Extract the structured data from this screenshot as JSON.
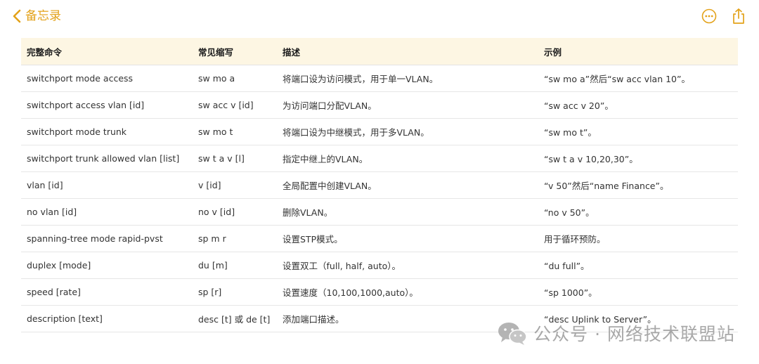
{
  "header": {
    "back_label": "备忘录",
    "accent_color": "#e3a21a",
    "icons": [
      "chevron-left-icon",
      "more-icon",
      "share-icon"
    ]
  },
  "table": {
    "columns": [
      "完整命令",
      "常见缩写",
      "描述",
      "示例"
    ],
    "rows": [
      [
        "switchport mode access",
        "sw mo a",
        "将端口设为访问模式，用于单一VLAN。",
        "“sw mo a”然后“sw acc vlan 10”。"
      ],
      [
        "switchport access vlan [id]",
        "sw acc v [id]",
        "为访问端口分配VLAN。",
        "“sw acc v 20”。"
      ],
      [
        "switchport mode trunk",
        "sw mo t",
        "将端口设为中继模式，用于多VLAN。",
        "“sw mo t”。"
      ],
      [
        "switchport trunk allowed vlan [list]",
        "sw t a v [l]",
        "指定中继上的VLAN。",
        "“sw t a v 10,20,30”。"
      ],
      [
        "vlan [id]",
        "v [id]",
        "全局配置中创建VLAN。",
        "“v 50”然后“name Finance”。"
      ],
      [
        "no vlan [id]",
        "no v [id]",
        "删除VLAN。",
        "“no v 50”。"
      ],
      [
        "spanning-tree mode rapid-pvst",
        "sp m r",
        "设置STP模式。",
        "用于循环预防。"
      ],
      [
        "duplex [mode]",
        "du [m]",
        "设置双工（full, half, auto）。",
        "“du full”。"
      ],
      [
        "speed [rate]",
        "sp [r]",
        "设置速度（10,100,1000,auto）。",
        "“sp 1000”。"
      ],
      [
        "description [text]",
        "desc [t] 或 de [t]",
        "添加端口描述。",
        "“desc Uplink to Server”。"
      ]
    ]
  },
  "watermark": {
    "text": "公众号 · 网络技术联盟站",
    "icon": "wechat-icon"
  }
}
